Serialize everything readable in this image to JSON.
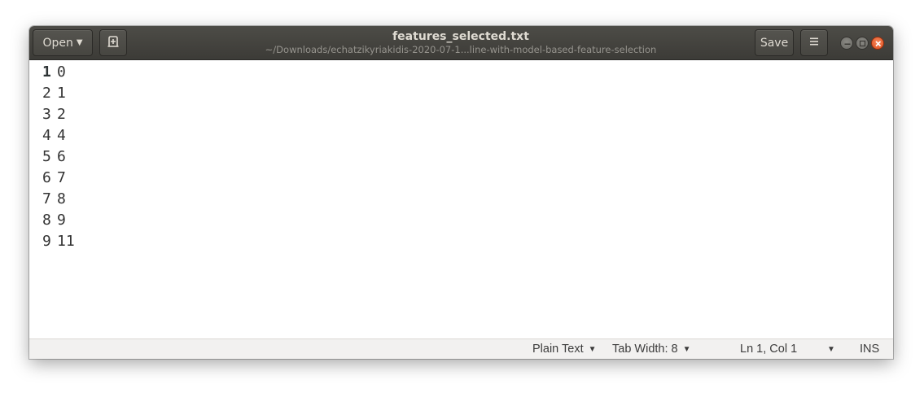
{
  "window": {
    "title": "features_selected.txt",
    "subtitle": "~/Downloads/echatzikyriakidis-2020-07-1...line-with-model-based-feature-selection"
  },
  "toolbar": {
    "open_label": "Open",
    "save_label": "Save"
  },
  "icons": {
    "open_caret": "chevron-down-icon",
    "new_tab": "new-document-icon",
    "menu": "hamburger-menu-icon",
    "minimize": "minimize-icon",
    "maximize": "maximize-icon",
    "close": "close-icon"
  },
  "colors": {
    "headerbar": "#3c3b37",
    "close_button": "#e0501f",
    "statusbar": "#f2f1f0"
  },
  "editor": {
    "lines": [
      {
        "number": "1",
        "text": "0"
      },
      {
        "number": "2",
        "text": "1"
      },
      {
        "number": "3",
        "text": "2"
      },
      {
        "number": "4",
        "text": "4"
      },
      {
        "number": "5",
        "text": "6"
      },
      {
        "number": "6",
        "text": "7"
      },
      {
        "number": "7",
        "text": "8"
      },
      {
        "number": "8",
        "text": "9"
      },
      {
        "number": "9",
        "text": "11"
      }
    ]
  },
  "statusbar": {
    "language": "Plain Text",
    "tab_width": "Tab Width: 8",
    "position": "Ln 1, Col 1",
    "mode": "INS"
  }
}
